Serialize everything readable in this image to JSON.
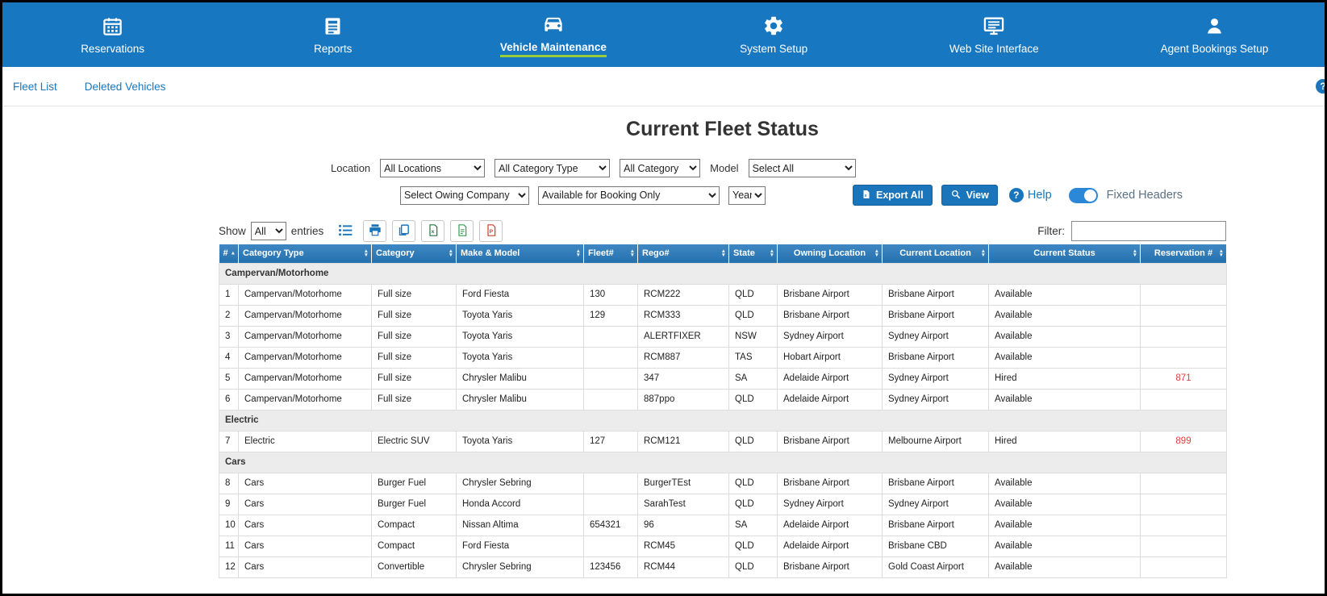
{
  "nav": {
    "items": [
      {
        "label": "Reservations",
        "icon": "calendar-icon",
        "active": false
      },
      {
        "label": "Reports",
        "icon": "reports-icon",
        "active": false
      },
      {
        "label": "Vehicle Maintenance",
        "icon": "car-icon",
        "active": true
      },
      {
        "label": "System Setup",
        "icon": "gear-icon",
        "active": false
      },
      {
        "label": "Web Site Interface",
        "icon": "monitor-icon",
        "active": false
      },
      {
        "label": "Agent Bookings Setup",
        "icon": "person-icon",
        "active": false
      }
    ]
  },
  "subnav": {
    "fleet_list": "Fleet List",
    "deleted_vehicles": "Deleted Vehicles",
    "help_glyph": "?"
  },
  "page": {
    "title": "Current Fleet Status"
  },
  "filters": {
    "location_label": "Location",
    "location_value": "All Locations",
    "category_type_value": "All Category Type",
    "category_value": "All Category",
    "model_label": "Model",
    "model_value": "Select All",
    "owning_company_value": "Select Owing Company",
    "availability_value": "Available for Booking Only",
    "year_value": "Year",
    "export_all_label": "Export All",
    "view_label": "View",
    "help_label": "Help",
    "help_glyph": "?",
    "fixed_headers_label": "Fixed Headers",
    "fixed_headers_on": true
  },
  "table_controls": {
    "show_label": "Show",
    "show_value": "All",
    "entries_label": "entries",
    "filter_label": "Filter:",
    "filter_value": ""
  },
  "table": {
    "columns": [
      {
        "key": "num",
        "label": "#",
        "sort": "asc"
      },
      {
        "key": "category_type",
        "label": "Category Type",
        "sort": "both"
      },
      {
        "key": "category",
        "label": "Category",
        "sort": "both"
      },
      {
        "key": "make_model",
        "label": "Make & Model",
        "sort": "both"
      },
      {
        "key": "fleet_no",
        "label": "Fleet#",
        "sort": "both"
      },
      {
        "key": "rego",
        "label": "Rego#",
        "sort": "both"
      },
      {
        "key": "state",
        "label": "State",
        "sort": "both"
      },
      {
        "key": "owning_location",
        "label": "Owning Location",
        "sort": "both"
      },
      {
        "key": "current_location",
        "label": "Current Location",
        "sort": "both"
      },
      {
        "key": "current_status",
        "label": "Current Status",
        "sort": "both"
      },
      {
        "key": "reservation",
        "label": "Reservation #",
        "sort": "both"
      }
    ],
    "fields": [
      "num",
      "category_type",
      "category",
      "make_model",
      "fleet_no",
      "rego",
      "state",
      "owning_location",
      "current_location",
      "current_status",
      "reservation"
    ],
    "groups": [
      {
        "name": "Campervan/Motorhome",
        "rows": [
          {
            "num": "1",
            "category_type": "Campervan/Motorhome",
            "category": "Full size",
            "make_model": "Ford Fiesta",
            "fleet_no": "130",
            "rego": "RCM222",
            "state": "QLD",
            "owning_location": "Brisbane Airport",
            "current_location": "Brisbane Airport",
            "current_status": "Available",
            "reservation": ""
          },
          {
            "num": "2",
            "category_type": "Campervan/Motorhome",
            "category": "Full size",
            "make_model": "Toyota Yaris",
            "fleet_no": "129",
            "rego": "RCM333",
            "state": "QLD",
            "owning_location": "Brisbane Airport",
            "current_location": "Brisbane Airport",
            "current_status": "Available",
            "reservation": ""
          },
          {
            "num": "3",
            "category_type": "Campervan/Motorhome",
            "category": "Full size",
            "make_model": "Toyota Yaris",
            "fleet_no": "",
            "rego": "ALERTFIXER",
            "state": "NSW",
            "owning_location": "Sydney Airport",
            "current_location": "Sydney Airport",
            "current_status": "Available",
            "reservation": ""
          },
          {
            "num": "4",
            "category_type": "Campervan/Motorhome",
            "category": "Full size",
            "make_model": "Toyota Yaris",
            "fleet_no": "",
            "rego": "RCM887",
            "state": "TAS",
            "owning_location": "Hobart Airport",
            "current_location": "Brisbane Airport",
            "current_status": "Available",
            "reservation": ""
          },
          {
            "num": "5",
            "category_type": "Campervan/Motorhome",
            "category": "Full size",
            "make_model": "Chrysler Malibu",
            "fleet_no": "",
            "rego": "347",
            "state": "SA",
            "owning_location": "Adelaide Airport",
            "current_location": "Sydney Airport",
            "current_status": "Hired",
            "reservation": "871"
          },
          {
            "num": "6",
            "category_type": "Campervan/Motorhome",
            "category": "Full size",
            "make_model": "Chrysler Malibu",
            "fleet_no": "",
            "rego": "887ppo",
            "state": "QLD",
            "owning_location": "Adelaide Airport",
            "current_location": "Sydney Airport",
            "current_status": "Available",
            "reservation": ""
          }
        ]
      },
      {
        "name": "Electric",
        "rows": [
          {
            "num": "7",
            "category_type": "Electric",
            "category": "Electric SUV",
            "make_model": "Toyota Yaris",
            "fleet_no": "127",
            "rego": "RCM121",
            "state": "QLD",
            "owning_location": "Brisbane Airport",
            "current_location": "Melbourne Airport",
            "current_status": "Hired",
            "reservation": "899"
          }
        ]
      },
      {
        "name": "Cars",
        "rows": [
          {
            "num": "8",
            "category_type": "Cars",
            "category": "Burger Fuel",
            "make_model": "Chrysler Sebring",
            "fleet_no": "",
            "rego": "BurgerTEst",
            "state": "QLD",
            "owning_location": "Brisbane Airport",
            "current_location": "Brisbane Airport",
            "current_status": "Available",
            "reservation": ""
          },
          {
            "num": "9",
            "category_type": "Cars",
            "category": "Burger Fuel",
            "make_model": "Honda Accord",
            "fleet_no": "",
            "rego": "SarahTest",
            "state": "QLD",
            "owning_location": "Sydney Airport",
            "current_location": "Sydney Airport",
            "current_status": "Available",
            "reservation": ""
          },
          {
            "num": "10",
            "category_type": "Cars",
            "category": "Compact",
            "make_model": "Nissan Altima",
            "fleet_no": "654321",
            "rego": "96",
            "state": "SA",
            "owning_location": "Adelaide Airport",
            "current_location": "Brisbane Airport",
            "current_status": "Available",
            "reservation": ""
          },
          {
            "num": "11",
            "category_type": "Cars",
            "category": "Compact",
            "make_model": "Ford Fiesta",
            "fleet_no": "",
            "rego": "RCM45",
            "state": "QLD",
            "owning_location": "Adelaide Airport",
            "current_location": "Brisbane CBD",
            "current_status": "Available",
            "reservation": ""
          },
          {
            "num": "12",
            "category_type": "Cars",
            "category": "Convertible",
            "make_model": "Chrysler Sebring",
            "fleet_no": "123456",
            "rego": "RCM44",
            "state": "QLD",
            "owning_location": "Brisbane Airport",
            "current_location": "Gold Coast Airport",
            "current_status": "Available",
            "reservation": ""
          }
        ]
      }
    ]
  },
  "colors": {
    "nav_blue": "#1777c0",
    "link_blue": "#1b75bb",
    "active_underline_green": "#9ccb3b",
    "table_header_blue": "#2471ae",
    "reservation_red": "#e03c3c",
    "toggle_blue": "#2b87d8",
    "excel_green": "#217346",
    "pdf_red": "#d33a2f"
  }
}
